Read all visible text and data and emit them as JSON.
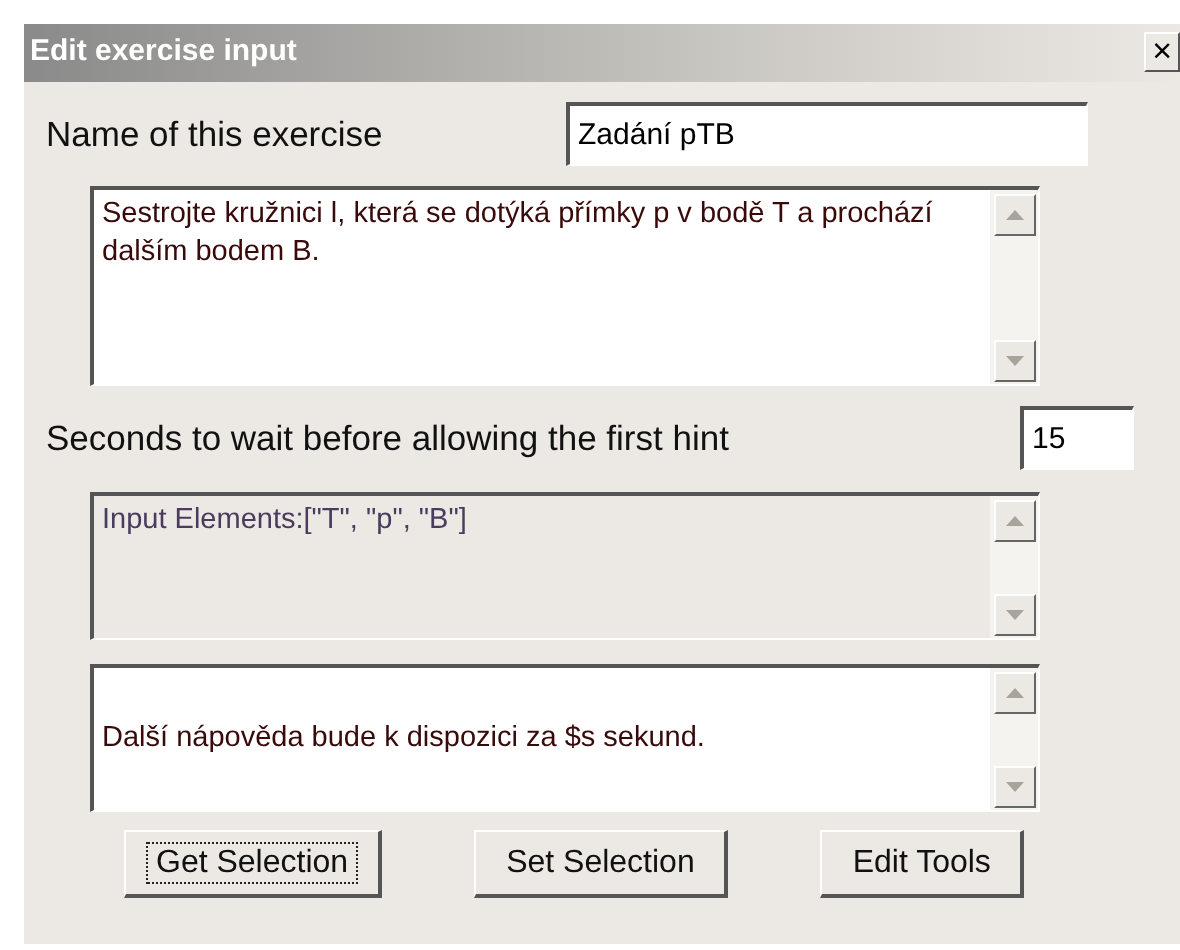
{
  "window": {
    "title": "Edit exercise input",
    "close": "×"
  },
  "name_field": {
    "label": "Name of this exercise",
    "value": "Zadání pTB"
  },
  "description": {
    "value": "Sestrojte kružnici l, která se dotýká přímky p v bodě T a prochází dalším bodem B.",
    "disabled": false
  },
  "hint_wait": {
    "label": "Seconds to wait before allowing the first hint",
    "value": "15"
  },
  "input_elements": {
    "value": "Input Elements:[\"T\", \"p\", \"B\"]",
    "disabled": true
  },
  "hint_message": {
    "value": "Další nápověda bude k dispozici za $s sekund.",
    "disabled": false
  },
  "buttons": [
    {
      "label": "Get Selection",
      "focused": true
    },
    {
      "label": "Set Selection",
      "focused": false
    },
    {
      "label": "Edit Tools",
      "focused": false
    }
  ]
}
